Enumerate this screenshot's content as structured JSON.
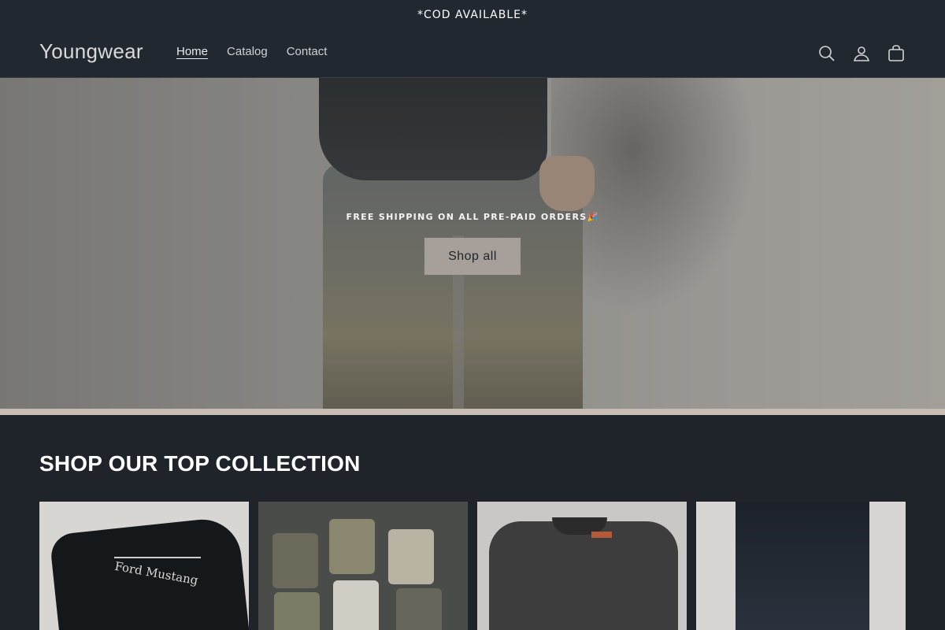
{
  "announcement": "*COD AVAILABLE*",
  "header": {
    "logo": "Youngwear",
    "nav": [
      {
        "label": "Home",
        "active": true
      },
      {
        "label": "Catalog",
        "active": false
      },
      {
        "label": "Contact",
        "active": false
      }
    ],
    "icons": [
      "search-icon",
      "account-icon",
      "cart-icon"
    ]
  },
  "hero": {
    "text": "FREE SHIPPING ON ALL PRE-PAID ORDERS🎉",
    "button_label": "Shop all"
  },
  "collection": {
    "title": "SHOP OUR TOP COLLECTION",
    "card1_print": "Ford Mustang"
  },
  "colors": {
    "background": "#1f242b",
    "header_bg": "#222830",
    "button_bg": "#a7a09a",
    "hero_bottom_strip": "#c7bdb3"
  }
}
